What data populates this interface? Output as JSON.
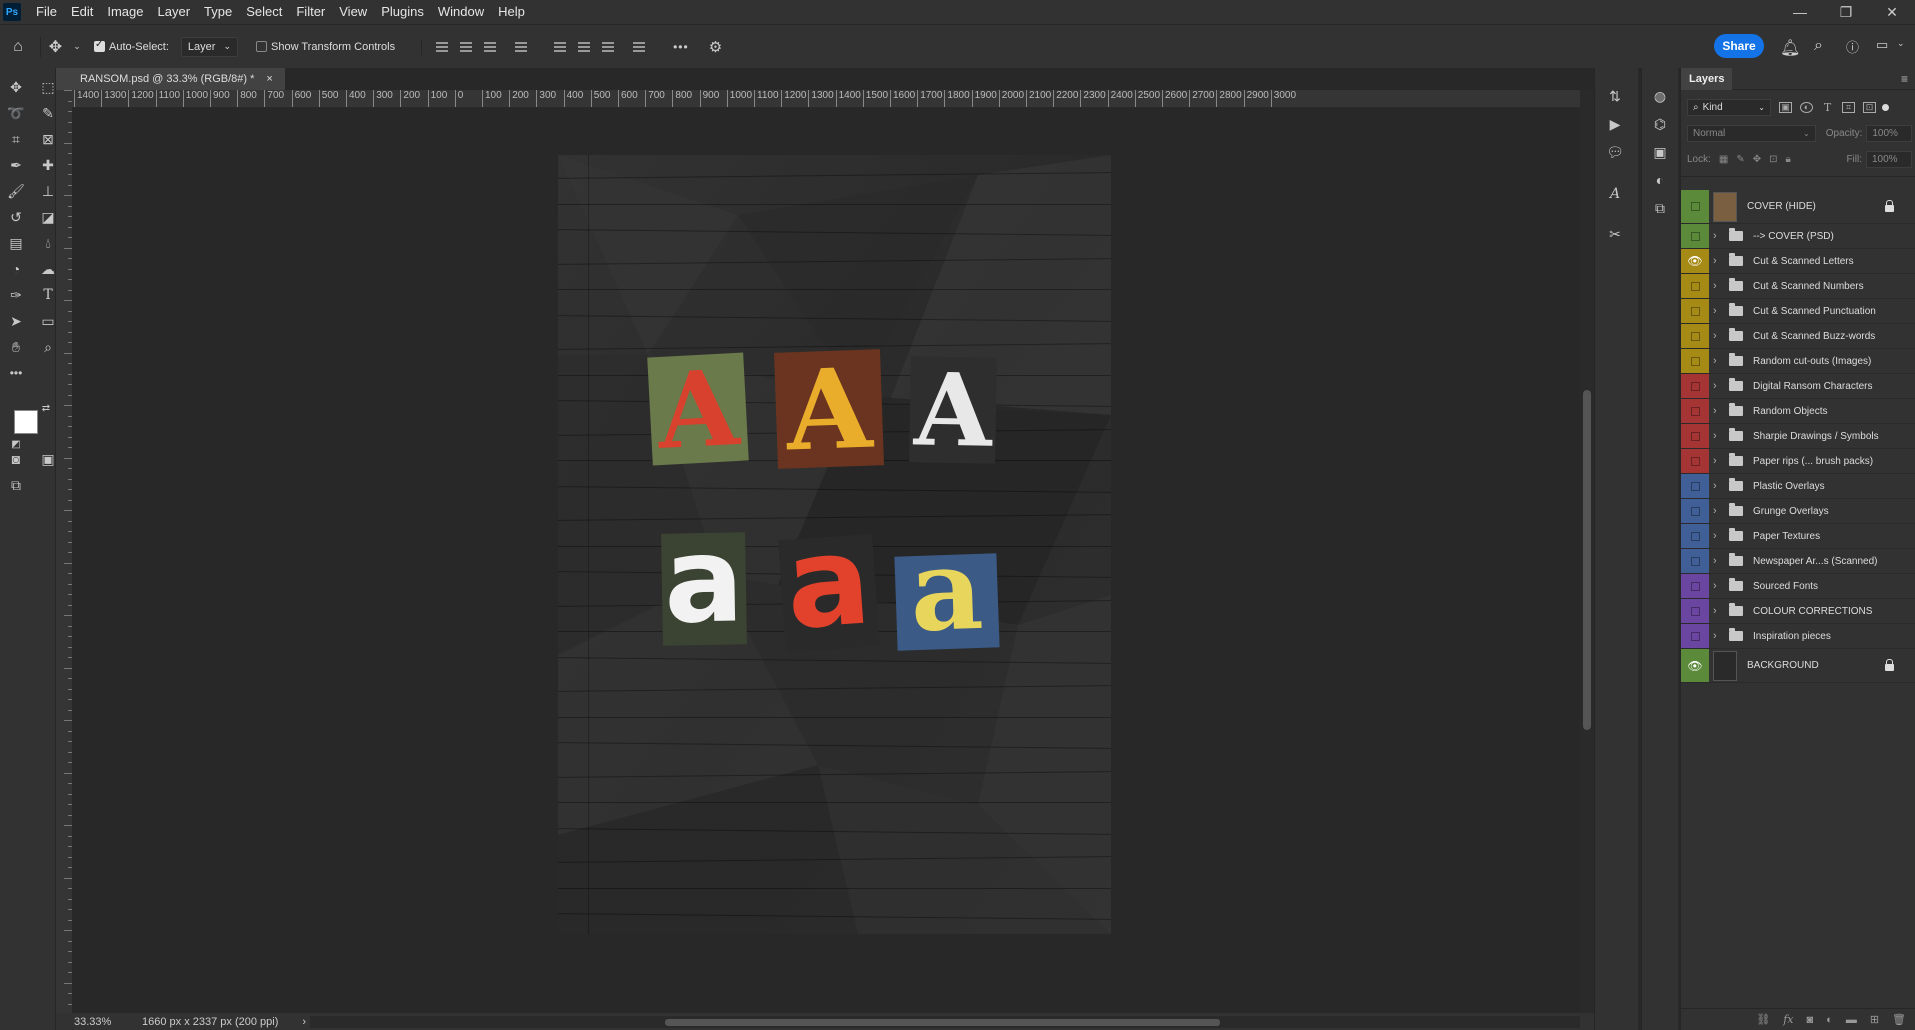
{
  "app": {
    "logo": "Ps"
  },
  "menu": [
    "File",
    "Edit",
    "Image",
    "Layer",
    "Type",
    "Select",
    "Filter",
    "View",
    "Plugins",
    "Window",
    "Help"
  ],
  "options": {
    "auto_select_label": "Auto-Select:",
    "auto_select_checked": true,
    "target_value": "Layer",
    "transform_label": "Show Transform Controls",
    "transform_checked": false,
    "more": "•••",
    "share_label": "Share"
  },
  "document": {
    "tab_title": "RANSOM.psd @ 33.3% (RGB/8#) *",
    "close": "×",
    "zoom": "33.33%",
    "info": "1660 px x 2337 px (200 ppi)",
    "status_arrow": "›",
    "letters_upper": [
      {
        "char": "A",
        "color": "#e0452f",
        "bg": "#6a7a4a",
        "fg": "#d7412d"
      },
      {
        "char": "A",
        "color": "#e9ac2b",
        "bg": "#6b3420",
        "fg": "#e9ac2b"
      },
      {
        "char": "A",
        "color": "#ececec",
        "bg": "#2e2e2e",
        "fg": "#e8e8e8"
      }
    ],
    "letters_lower": [
      {
        "char": "a",
        "bg": "#3b4432",
        "fg": "#f2f2f2"
      },
      {
        "char": "a",
        "bg": "#2a2a2a",
        "fg": "#e2412b"
      },
      {
        "char": "a",
        "bg": "#3c5a86",
        "fg": "#e8d55c"
      }
    ]
  },
  "ruler_h": [
    "1400",
    "1300",
    "1200",
    "1100",
    "1000",
    "900",
    "800",
    "700",
    "600",
    "500",
    "400",
    "300",
    "200",
    "100",
    "0",
    "100",
    "200",
    "300",
    "400",
    "500",
    "600",
    "700",
    "800",
    "900",
    "1000",
    "1100",
    "1200",
    "1300",
    "1400",
    "1500",
    "1600",
    "1700",
    "1800",
    "1900",
    "2000",
    "2100",
    "2200",
    "2300",
    "2400",
    "2500",
    "2600",
    "2700",
    "2800",
    "2900",
    "3000"
  ],
  "layers": {
    "tab": "Layers",
    "filter_kind": "Kind",
    "blend_mode": "Normal",
    "opacity_label": "Opacity:",
    "opacity_value": "100%",
    "lock_label": "Lock:",
    "fill_label": "Fill:",
    "fill_value": "100%",
    "items": [
      {
        "name": "COVER (HIDE)",
        "type": "pixel",
        "color": "#5a8a3a",
        "visible": false,
        "locked": true,
        "thumb": "#7a6040"
      },
      {
        "name": "--> COVER (PSD)",
        "type": "group",
        "color": "#5a8a3a",
        "visible": false,
        "locked": false
      },
      {
        "name": "Cut & Scanned Letters",
        "type": "group",
        "color": "#a58a16",
        "visible": true,
        "locked": false
      },
      {
        "name": "Cut & Scanned Numbers",
        "type": "group",
        "color": "#a58a16",
        "visible": false,
        "locked": false
      },
      {
        "name": "Cut & Scanned Punctuation",
        "type": "group",
        "color": "#a58a16",
        "visible": false,
        "locked": false
      },
      {
        "name": "Cut & Scanned Buzz-words",
        "type": "group",
        "color": "#a58a16",
        "visible": false,
        "locked": false
      },
      {
        "name": "Random cut-outs (Images)",
        "type": "group",
        "color": "#a58a16",
        "visible": false,
        "locked": false
      },
      {
        "name": "Digital Ransom Characters",
        "type": "group",
        "color": "#a53535",
        "visible": false,
        "locked": false
      },
      {
        "name": "Random Objects",
        "type": "group",
        "color": "#a53535",
        "visible": false,
        "locked": false
      },
      {
        "name": "Sharpie Drawings / Symbols",
        "type": "group",
        "color": "#a53535",
        "visible": false,
        "locked": false
      },
      {
        "name": "Paper rips (... brush packs)",
        "type": "group",
        "color": "#a53535",
        "visible": false,
        "locked": false
      },
      {
        "name": "Plastic Overlays",
        "type": "group",
        "color": "#3f5f96",
        "visible": false,
        "locked": false
      },
      {
        "name": "Grunge Overlays",
        "type": "group",
        "color": "#3f5f96",
        "visible": false,
        "locked": false
      },
      {
        "name": "Paper Textures",
        "type": "group",
        "color": "#3f5f96",
        "visible": false,
        "locked": false
      },
      {
        "name": "Newspaper Ar...s (Scanned)",
        "type": "group",
        "color": "#3f5f96",
        "visible": false,
        "locked": false
      },
      {
        "name": "Sourced Fonts",
        "type": "group",
        "color": "#6a46a0",
        "visible": false,
        "locked": false
      },
      {
        "name": "COLOUR CORRECTIONS",
        "type": "group",
        "color": "#6a46a0",
        "visible": false,
        "locked": false
      },
      {
        "name": "Inspiration pieces",
        "type": "group",
        "color": "#6a46a0",
        "visible": false,
        "locked": false
      },
      {
        "name": "BACKGROUND",
        "type": "pixel",
        "color": "#5a8a3a",
        "visible": true,
        "locked": true,
        "thumb": "#2a2a2a"
      }
    ]
  }
}
